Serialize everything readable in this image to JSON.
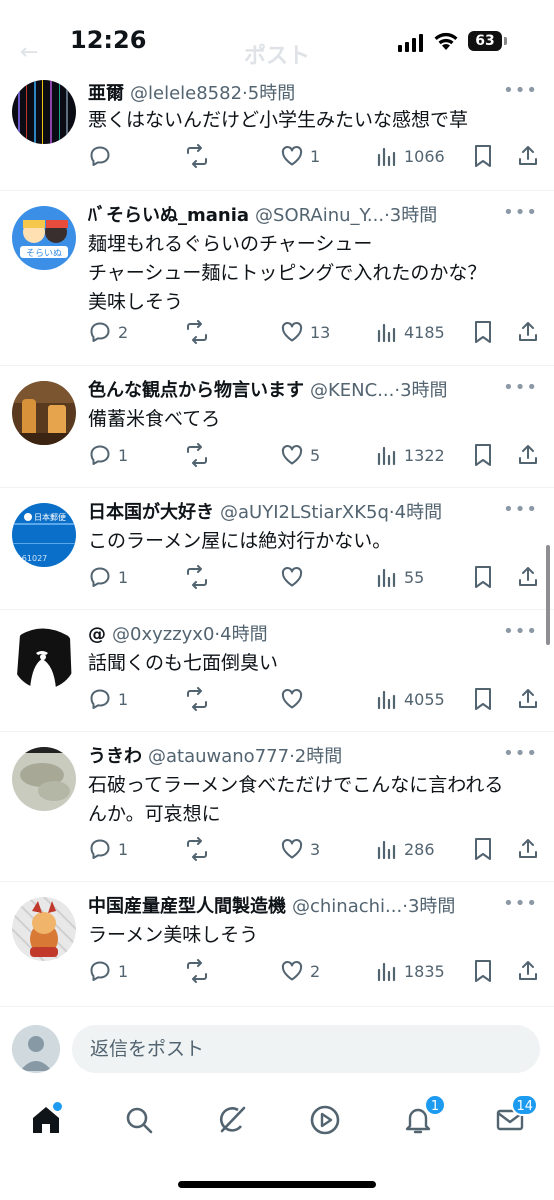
{
  "status": {
    "time": "12:26",
    "battery": "63"
  },
  "header": {
    "title": "ポスト"
  },
  "tweets": [
    {
      "name": "亜爾",
      "handle": "@lelele8582",
      "sep": "·",
      "time": "5時間",
      "lines": [
        "悪くはないんだけど小学生みたいな感想で草"
      ],
      "replies": "",
      "likes": "1",
      "views": "1066"
    },
    {
      "name": "ﾊﾞそらいぬ_mania",
      "handle": "@SORAinu_Y...",
      "sep": "·",
      "time": "3時間",
      "lines": [
        "麺埋もれるぐらいのチャーシュー",
        "チャーシュー麺にトッピングで入れたのかな？",
        "美味しそう"
      ],
      "replies": "2",
      "likes": "13",
      "views": "4185"
    },
    {
      "name": "色んな観点から物言います",
      "handle": "@KENC...",
      "sep": "·",
      "time": "3時間",
      "lines": [
        "備蓄米食べてろ"
      ],
      "replies": "1",
      "likes": "5",
      "views": "1322"
    },
    {
      "name": "日本国が大好き",
      "handle": "@aUYI2LStiarXK5q",
      "sep": "·",
      "time": "4時間",
      "lines": [
        "このラーメン屋には絶対行かない。"
      ],
      "replies": "1",
      "likes": "",
      "views": "55"
    },
    {
      "name": "@",
      "handle": "@0xyzzyx0",
      "sep": "·",
      "time": "4時間",
      "lines": [
        "話聞くのも七面倒臭い"
      ],
      "replies": "1",
      "likes": "",
      "views": "4055"
    },
    {
      "name": "うきわ",
      "handle": "@atauwano777",
      "sep": "·",
      "time": "2時間",
      "lines": [
        "石破ってラーメン食べただけでこんなに言われる",
        "んか。可哀想に"
      ],
      "replies": "1",
      "likes": "3",
      "views": "286"
    },
    {
      "name": "中国産量産型人間製造機",
      "handle": "@chinachi...",
      "sep": "·",
      "time": "3時間",
      "lines": [
        "ラーメン美味しそう"
      ],
      "replies": "1",
      "likes": "2",
      "views": "1835"
    }
  ],
  "reply": {
    "placeholder": "返信をポスト"
  },
  "nav": {
    "items": [
      {
        "name": "home-icon",
        "badge": ""
      },
      {
        "name": "search-icon",
        "badge": ""
      },
      {
        "name": "grok-icon",
        "badge": ""
      },
      {
        "name": "video-icon",
        "badge": ""
      },
      {
        "name": "notifications-icon",
        "badge": "1"
      },
      {
        "name": "messages-icon",
        "badge": "14"
      }
    ]
  },
  "colors": {
    "accent": "#1d9bf0",
    "text": "#0f1419",
    "muted": "#536471"
  }
}
